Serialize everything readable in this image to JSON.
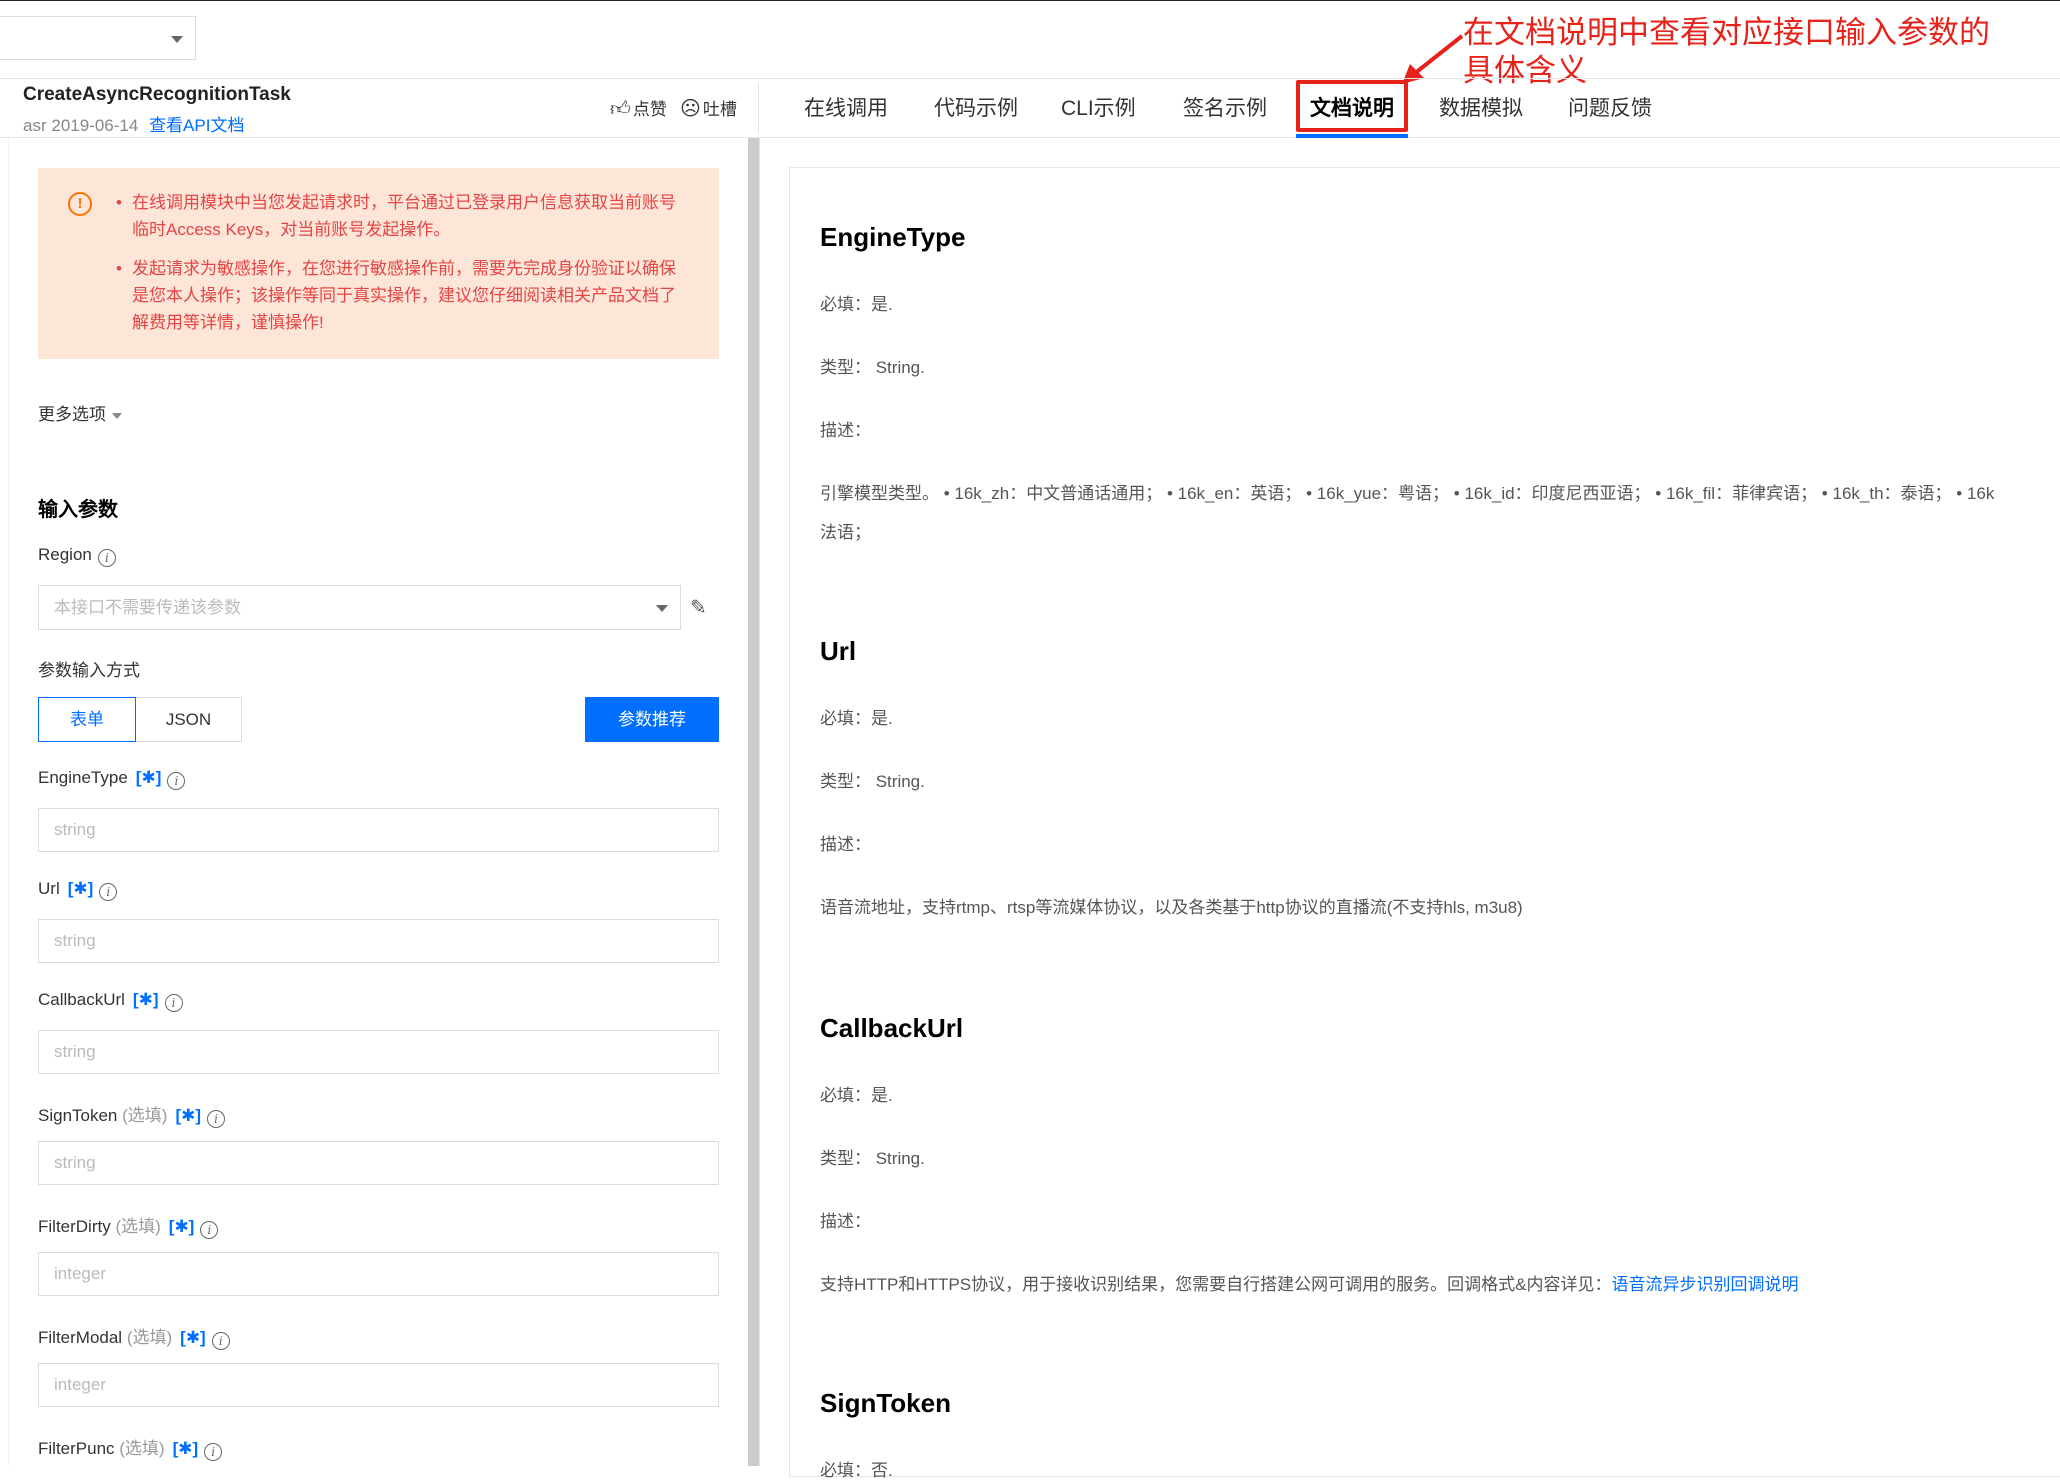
{
  "annotation": {
    "text_line1": "在文档说明中查看对应接口输入参数的",
    "text_line2": "具体含义"
  },
  "header": {
    "api_name": "CreateAsyncRecognitionTask",
    "product": "asr",
    "version_date": "2019-06-14",
    "doc_link": "查看API文档",
    "like_label": "点赞",
    "dislike_label": "吐槽",
    "like_icon": "thumbs-up-icon",
    "dislike_icon": "frown-face-icon"
  },
  "tabs": [
    {
      "label": "在线调用",
      "active": false
    },
    {
      "label": "代码示例",
      "active": false
    },
    {
      "label": "CLI示例",
      "active": false
    },
    {
      "label": "签名示例",
      "active": false
    },
    {
      "label": "文档说明",
      "active": true
    },
    {
      "label": "数据模拟",
      "active": false
    },
    {
      "label": "问题反馈",
      "active": false
    }
  ],
  "warning": {
    "bullet1": "在线调用模块中当您发起请求时，平台通过已登录用户信息获取当前账号临时Access Keys，对当前账号发起操作。",
    "bullet2": "发起请求为敏感操作，在您进行敏感操作前，需要先完成身份验证以确保是您本人操作；该操作等同于真实操作，建议您仔细阅读相关产品文档了解费用等详情，谨慎操作!"
  },
  "more_options": "更多选项",
  "input_params_title": "输入参数",
  "region": {
    "label": "Region",
    "placeholder": "本接口不需要传递该参数"
  },
  "param_mode": {
    "label": "参数输入方式",
    "form": "表单",
    "json": "JSON",
    "recommend": "参数推荐"
  },
  "fields": [
    {
      "name": "EngineType",
      "optional": "",
      "required_mark": "[✱]",
      "placeholder": "string"
    },
    {
      "name": "Url",
      "optional": "",
      "required_mark": "[✱]",
      "placeholder": "string"
    },
    {
      "name": "CallbackUrl",
      "optional": "",
      "required_mark": "[✱]",
      "placeholder": "string"
    },
    {
      "name": "SignToken",
      "optional": "(选填)",
      "required_mark": "[✱]",
      "placeholder": "string"
    },
    {
      "name": "FilterDirty",
      "optional": "(选填)",
      "required_mark": "[✱]",
      "placeholder": "integer"
    },
    {
      "name": "FilterModal",
      "optional": "(选填)",
      "required_mark": "[✱]",
      "placeholder": "integer"
    },
    {
      "name": "FilterPunc",
      "optional": "(选填)",
      "required_mark": "[✱]",
      "placeholder": ""
    }
  ],
  "docs": [
    {
      "title": "EngineType",
      "required": "必填：是.",
      "type": "类型： String.",
      "desc_label": "描述：",
      "desc": "引擎模型类型。 • 16k_zh：中文普通话通用； • 16k_en：英语； • 16k_yue：粤语； • 16k_id：印度尼西亚语； • 16k_fil：菲律宾语； • 16k_th：泰语； • 16k",
      "desc2": "法语；"
    },
    {
      "title": "Url",
      "required": "必填：是.",
      "type": "类型： String.",
      "desc_label": "描述：",
      "desc": "语音流地址，支持rtmp、rtsp等流媒体协议，以及各类基于http协议的直播流(不支持hls, m3u8)"
    },
    {
      "title": "CallbackUrl",
      "required": "必填：是.",
      "type": "类型： String.",
      "desc_label": "描述：",
      "desc": "支持HTTP和HTTPS协议，用于接收识别结果，您需要自行搭建公网可调用的服务。回调格式&内容详见：",
      "desc_link": "语音流异步识别回调说明"
    },
    {
      "title": "SignToken",
      "required": "必填：否."
    }
  ],
  "colors": {
    "accent": "#006eff",
    "annotation_red": "#e5231b",
    "warning_bg": "#fde5d8",
    "warning_text": "#e54545"
  }
}
